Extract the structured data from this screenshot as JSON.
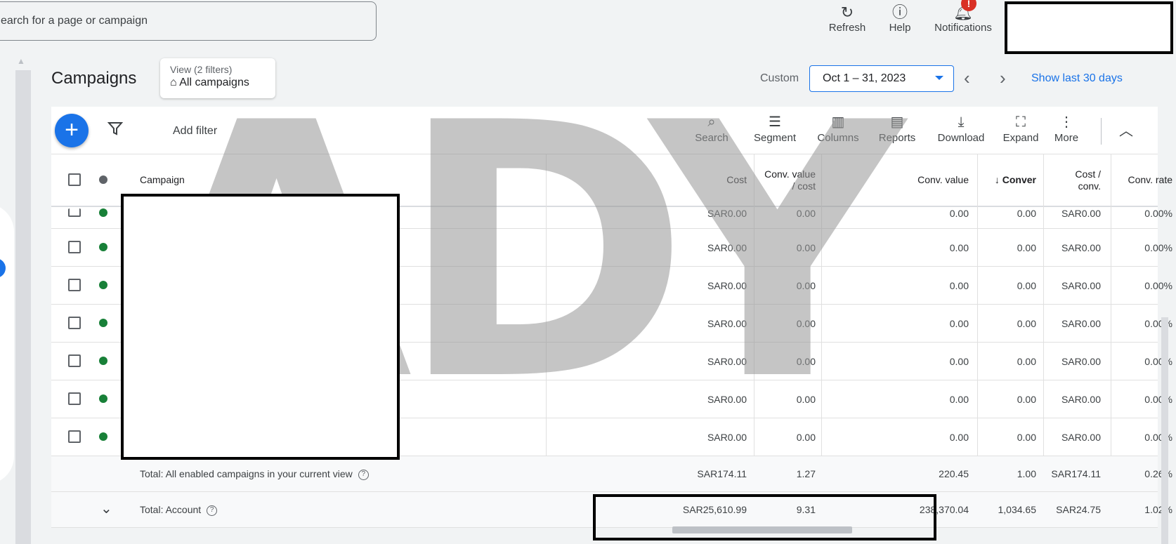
{
  "topbar": {
    "search_placeholder": "earch for a page or campaign",
    "refresh_label": "Refresh",
    "help_label": "Help",
    "notifications_label": "Notifications",
    "notification_badge": "!"
  },
  "header": {
    "title": "Campaigns",
    "view_filters": "View (2 filters)",
    "view_name": "All campaigns",
    "custom_label": "Custom",
    "date_range": "Oct 1 – 31, 2023",
    "show_last": "Show last 30 days"
  },
  "toolbar": {
    "add_filter": "Add filter",
    "search": "Search",
    "segment": "Segment",
    "columns": "Columns",
    "reports": "Reports",
    "download": "Download",
    "expand": "Expand",
    "more": "More"
  },
  "table": {
    "columns": {
      "campaign": "Campaign",
      "cost": "Cost",
      "conv_value_cost_1": "Conv. value",
      "conv_value_cost_2": "/ cost",
      "conv_value": "Conv. value",
      "conversions": "Conver",
      "cost_per_conv_1": "Cost /",
      "cost_per_conv_2": "conv.",
      "conv_rate": "Conv. rate"
    },
    "rows": [
      {
        "cost": "SAR0.00",
        "cvc": "0.00",
        "cv": "0.00",
        "conv": "0.00",
        "cpc": "SAR0.00",
        "rate": "0.00%"
      },
      {
        "cost": "SAR0.00",
        "cvc": "0.00",
        "cv": "0.00",
        "conv": "0.00",
        "cpc": "SAR0.00",
        "rate": "0.00%"
      },
      {
        "cost": "SAR0.00",
        "cvc": "0.00",
        "cv": "0.00",
        "conv": "0.00",
        "cpc": "SAR0.00",
        "rate": "0.00%"
      },
      {
        "cost": "SAR0.00",
        "cvc": "0.00",
        "cv": "0.00",
        "conv": "0.00",
        "cpc": "SAR0.00",
        "rate": "0.00%"
      },
      {
        "cost": "SAR0.00",
        "cvc": "0.00",
        "cv": "0.00",
        "conv": "0.00",
        "cpc": "SAR0.00",
        "rate": "0.00%"
      },
      {
        "cost": "SAR0.00",
        "cvc": "0.00",
        "cv": "0.00",
        "conv": "0.00",
        "cpc": "SAR0.00",
        "rate": "0.00%"
      },
      {
        "cost": "SAR0.00",
        "cvc": "0.00",
        "cv": "0.00",
        "conv": "0.00",
        "cpc": "SAR0.00",
        "rate": "0.00%"
      }
    ],
    "total_enabled": {
      "label": "Total: All enabled campaigns in your current view",
      "cost": "SAR174.11",
      "cvc": "1.27",
      "cv": "220.45",
      "conv": "1.00",
      "cpc": "SAR174.11",
      "rate": "0.26%"
    },
    "total_account": {
      "label": "Total: Account",
      "cost": "SAR25,610.99",
      "cvc": "9.31",
      "cv": "238,370.04",
      "conv": "1,034.65",
      "cpc": "SAR24.75",
      "rate": "1.02%"
    }
  },
  "watermark": "ADY",
  "colors": {
    "accent": "#1a73e8",
    "status_enabled": "#188038",
    "alert": "#d93025"
  }
}
